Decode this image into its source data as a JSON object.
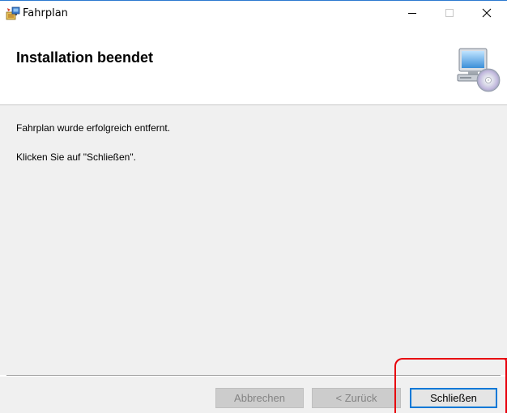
{
  "window": {
    "title": "Fahrplan",
    "icon": "installer-package-icon",
    "controls": [
      "minimize-icon",
      "maximize-icon",
      "close-icon"
    ]
  },
  "banner": {
    "title": "Installation beendet",
    "graphic": "computer-disc-icon"
  },
  "content": {
    "message": "Fahrplan wurde erfolgreich entfernt.",
    "instruction": "Klicken Sie auf \"Schließen\"."
  },
  "buttons": {
    "cancel": "Abbrechen",
    "back": "< Zurück",
    "finish": "Schließen"
  },
  "colors": {
    "accent": "#0078d7",
    "highlight": "#e8000b",
    "title_border": "#2b79d0"
  }
}
